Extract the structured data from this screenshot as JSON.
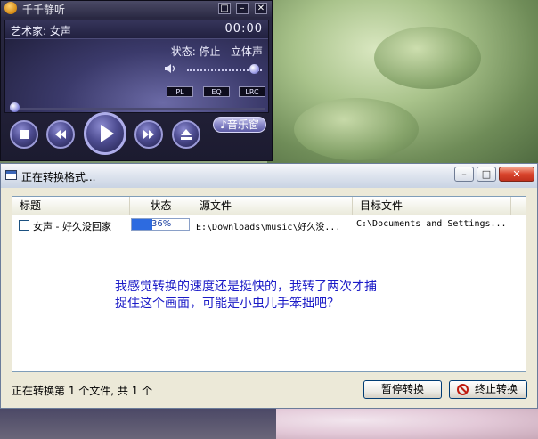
{
  "player": {
    "title": "千千静听",
    "window_buttons": [
      "□",
      "–",
      "✕"
    ],
    "artist": "艺术家: 女声",
    "time": "00:00",
    "status": "状态: 停止   立体声",
    "volume_level": 0.9,
    "buttons": {
      "pl": "PL",
      "eq": "EQ",
      "lrc": "LRC",
      "music_window": "♪音乐窗"
    },
    "icons": [
      "stop-icon",
      "prev-icon",
      "play-icon",
      "next-icon",
      "eject-icon",
      "volume-icon"
    ]
  },
  "dialog": {
    "title": "正在转换格式...",
    "window_buttons": {
      "minimize": "–",
      "maximize": "□",
      "close": "✕"
    },
    "columns": [
      "标题",
      "状态",
      "源文件",
      "目标文件"
    ],
    "rows": [
      {
        "title": "女声 - 好久没回家",
        "progress": "36%",
        "progress_value": 0.36,
        "source": "E:\\Downloads\\music\\好久没...",
        "target": "C:\\Documents and Settings..."
      }
    ],
    "annotation": "我感觉转换的速度还是挺快的，我转了两次才捕\n捉住这个画面，可能是小虫儿手笨拙吧？",
    "status_line": "正在转换第 1 个文件, 共 1 个",
    "pause_button": "暂停转换",
    "stop_button": "终止转换"
  },
  "colors": {
    "annotation": "#1b1bc7",
    "progress": "#2d6be0"
  }
}
